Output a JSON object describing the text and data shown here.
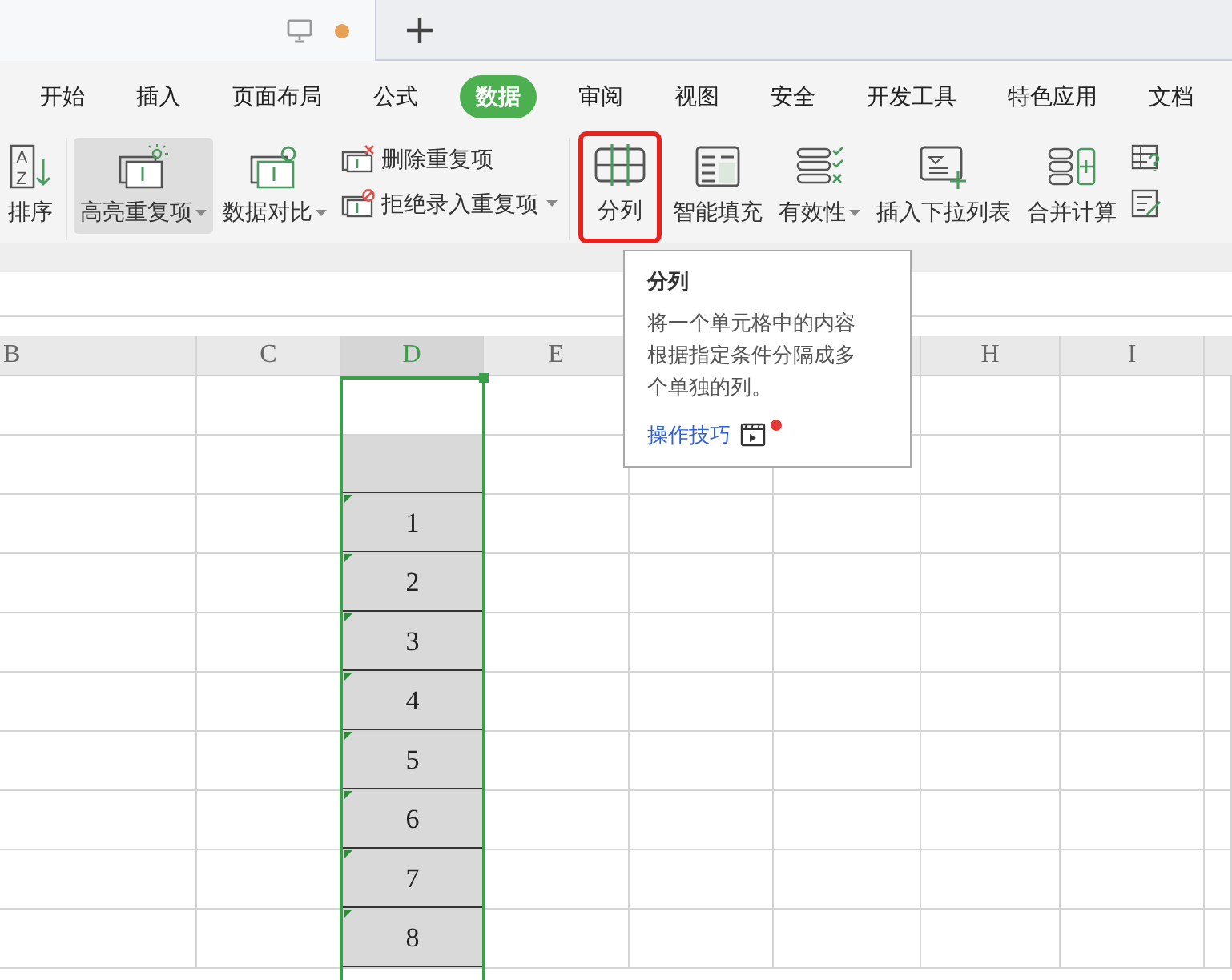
{
  "title_bar": {
    "unsaved": true
  },
  "menu_tabs": [
    {
      "label": "开始",
      "selected": false
    },
    {
      "label": "插入",
      "selected": false
    },
    {
      "label": "页面布局",
      "selected": false
    },
    {
      "label": "公式",
      "selected": false
    },
    {
      "label": "数据",
      "selected": true
    },
    {
      "label": "审阅",
      "selected": false
    },
    {
      "label": "视图",
      "selected": false
    },
    {
      "label": "安全",
      "selected": false
    },
    {
      "label": "开发工具",
      "selected": false
    },
    {
      "label": "特色应用",
      "selected": false
    },
    {
      "label": "文档",
      "selected": false
    }
  ],
  "toolbar": [
    {
      "kind": "large",
      "icon_letters": [
        "A",
        "Z"
      ],
      "label": "排序",
      "dropdown": false,
      "pressed": false,
      "highlighted": false
    },
    {
      "kind": "divider"
    },
    {
      "kind": "large",
      "label": "高亮重复项",
      "dropdown": true,
      "pressed": true,
      "highlighted": false
    },
    {
      "kind": "large",
      "label": "数据对比",
      "dropdown": true,
      "pressed": false,
      "highlighted": false
    },
    {
      "kind": "stack",
      "items": [
        {
          "label": "删除重复项",
          "dropdown": false
        },
        {
          "label": "拒绝录入重复项",
          "dropdown": true
        }
      ]
    },
    {
      "kind": "divider"
    },
    {
      "kind": "large",
      "label": "分列",
      "dropdown": false,
      "pressed": false,
      "highlighted": true
    },
    {
      "kind": "large",
      "label": "智能填充",
      "dropdown": false,
      "pressed": false,
      "highlighted": false
    },
    {
      "kind": "large",
      "label": "有效性",
      "dropdown": true,
      "pressed": false,
      "highlighted": false
    },
    {
      "kind": "large",
      "label": "插入下拉列表",
      "dropdown": false,
      "pressed": false,
      "highlighted": false
    },
    {
      "kind": "large",
      "label": "合并计算",
      "dropdown": false,
      "pressed": false,
      "highlighted": false
    },
    {
      "kind": "stack",
      "items": [
        {
          "dropdown": false
        },
        {
          "dropdown": false
        }
      ]
    }
  ],
  "columns": [
    {
      "label": "B",
      "selected": false
    },
    {
      "label": "C",
      "selected": false
    },
    {
      "label": "D",
      "selected": true
    },
    {
      "label": "E",
      "selected": false
    },
    {
      "label": "H",
      "selected": false
    },
    {
      "label": "I",
      "selected": false
    }
  ],
  "column_d_cells": [
    {
      "shaded": true
    },
    {
      "value": "1",
      "shaded": true
    },
    {
      "value": "2",
      "shaded": true
    },
    {
      "value": "3",
      "shaded": true
    },
    {
      "value": "4",
      "shaded": true
    },
    {
      "value": "5",
      "shaded": true
    },
    {
      "value": "6",
      "shaded": true
    },
    {
      "value": "7",
      "shaded": true
    },
    {
      "value": "8",
      "shaded": true
    }
  ],
  "tooltip": {
    "title": "分列",
    "description": "将一个单元格中的内容根据指定条件分隔成多个单独的列。",
    "link": "操作技巧",
    "new_badge": true
  }
}
